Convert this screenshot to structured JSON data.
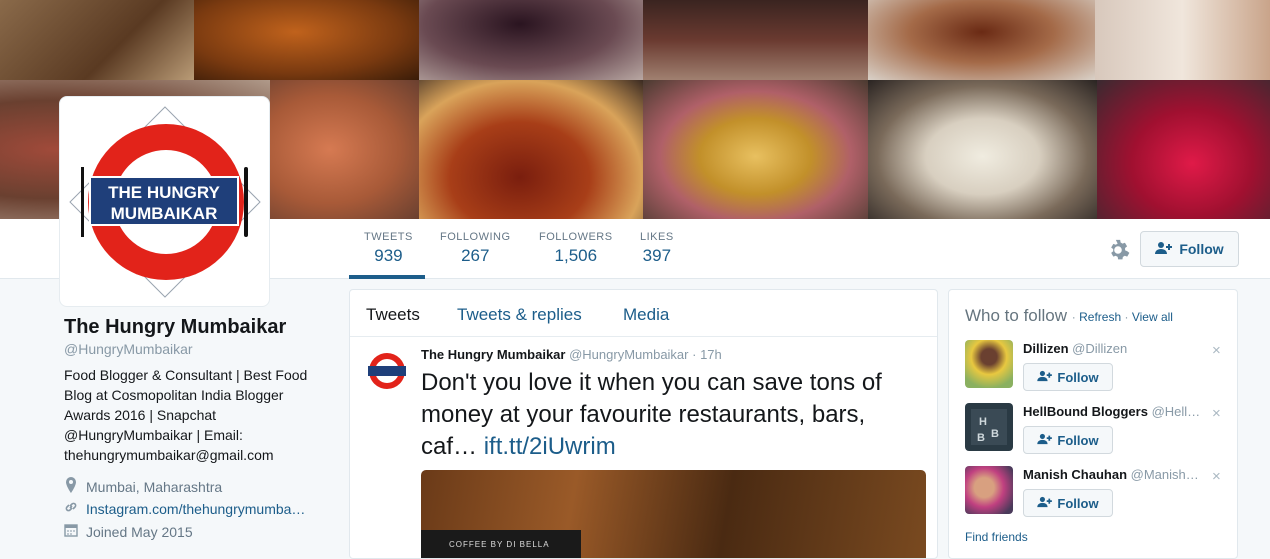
{
  "profile": {
    "name": "The Hungry Mumbaikar",
    "handle": "@HungryMumbaikar",
    "bio": "Food Blogger & Consultant | Best Food Blog at Cosmopolitan India Blogger Awards 2016 | Snapchat @HungryMumbaikar | Email: thehungrymumbaikar@gmail.com",
    "location": "Mumbai, Maharashtra",
    "website": "Instagram.com/thehungrymumba…",
    "joined": "Joined May 2015",
    "logo_line1": "THE HUNGRY",
    "logo_line2": "MUMBAIKAR"
  },
  "stats": [
    {
      "label": "TWEETS",
      "value": "939"
    },
    {
      "label": "FOLLOWING",
      "value": "267"
    },
    {
      "label": "FOLLOWERS",
      "value": "1,506"
    },
    {
      "label": "LIKES",
      "value": "397"
    }
  ],
  "follow_label": "Follow",
  "timeline": {
    "tabs": [
      "Tweets",
      "Tweets & replies",
      "Media"
    ],
    "tweet": {
      "author": "The Hungry Mumbaikar",
      "handle": "@HungryMumbaikar",
      "time": "· 17h",
      "text": "Don't you love it when you can save tons of money at your favourite restaurants, bars, caf…",
      "link": "ift.tt/2iUwrim",
      "media_label": "COFFEE BY DI BELLA"
    }
  },
  "who_to_follow": {
    "title": "Who to follow",
    "refresh": "Refresh",
    "view_all": "View all",
    "sep": "·",
    "suggestions": [
      {
        "name": "Dillizen",
        "handle": "@Dillizen",
        "follow": "Follow"
      },
      {
        "name": "HellBound Bloggers",
        "handle": "@Hell…",
        "follow": "Follow"
      },
      {
        "name": "Manish Chauhan",
        "handle": "@Manish…",
        "follow": "Follow"
      }
    ],
    "find_friends": "Find friends",
    "close": "×"
  },
  "colors": {
    "link": "#1c5d8a",
    "muted": "#657786",
    "logo_red": "#e2231a",
    "logo_blue": "#1f3f7a"
  }
}
